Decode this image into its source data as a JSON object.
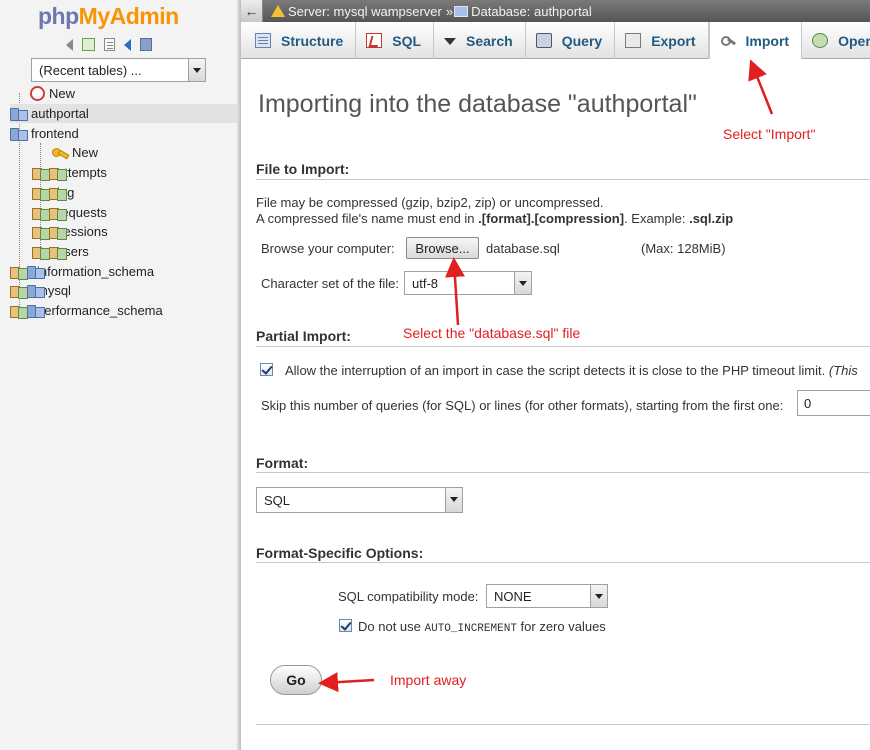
{
  "nav": {
    "logo_php": "php",
    "logo_myadmin": "MyAdmin",
    "recent_tables": "(Recent tables) ...",
    "tree": {
      "new_top": "New",
      "databases": [
        {
          "label": "authportal"
        },
        {
          "label": "frontend"
        },
        {
          "label": "information_schema"
        },
        {
          "label": "mysql"
        },
        {
          "label": "performance_schema"
        }
      ],
      "frontend_new": "New",
      "tables": [
        "attempts",
        "log",
        "requests",
        "sessions",
        "users"
      ]
    }
  },
  "topbar": {
    "back_icon": "←",
    "server": "Server: mysql wampserver",
    "separator": "»",
    "database": "Database: authportal"
  },
  "tabs": [
    {
      "label": "Structure",
      "icon": "structure-icon"
    },
    {
      "label": "SQL",
      "icon": "sql-icon"
    },
    {
      "label": "Search",
      "icon": "search-icon"
    },
    {
      "label": "Query",
      "icon": "query-icon"
    },
    {
      "label": "Export",
      "icon": "export-icon"
    },
    {
      "label": "Import",
      "icon": "import-icon",
      "active": true
    },
    {
      "label": "Operations",
      "icon": "operations-icon"
    }
  ],
  "main": {
    "title": "Importing into the database \"authportal\"",
    "file_section": {
      "title": "File to Import:",
      "line1": "File may be compressed (gzip, bzip2, zip) or uncompressed.",
      "line2_prefix": "A compressed file's name must end in ",
      "line2_bold": ".[format].[compression]",
      "line2_mid": ". Example: ",
      "line2_example": ".sql.zip",
      "browse_label": "Browse your computer:",
      "browse_button": "Browse...",
      "file_name": "database.sql",
      "max_size": "(Max: 128MiB)",
      "charset_label": "Character set of the file:",
      "charset_value": "utf-8"
    },
    "partial_section": {
      "title": "Partial Import:",
      "allow_interrupt": "Allow the interruption of an import in case the script detects it is close to the PHP timeout limit.",
      "allow_interrupt_tail": "(This",
      "allow_interrupt_checked": true,
      "skip_label": "Skip this number of queries (for SQL) or lines (for other formats), starting from the first one:",
      "skip_value": "0"
    },
    "format_section": {
      "title": "Format:",
      "format_value": "SQL"
    },
    "options_section": {
      "title": "Format-Specific Options:",
      "compat_label": "SQL compatibility mode:",
      "compat_value": "NONE",
      "auto_inc_prefix": "Do not use ",
      "auto_inc_code": "AUTO_INCREMENT",
      "auto_inc_suffix": " for zero values",
      "auto_inc_checked": true
    },
    "go_button": "Go"
  },
  "annotations": {
    "select_import": "Select \"Import\"",
    "select_file": "Select the \"database.sql\" file",
    "import_away": "Import away",
    "color": "#e02020"
  }
}
